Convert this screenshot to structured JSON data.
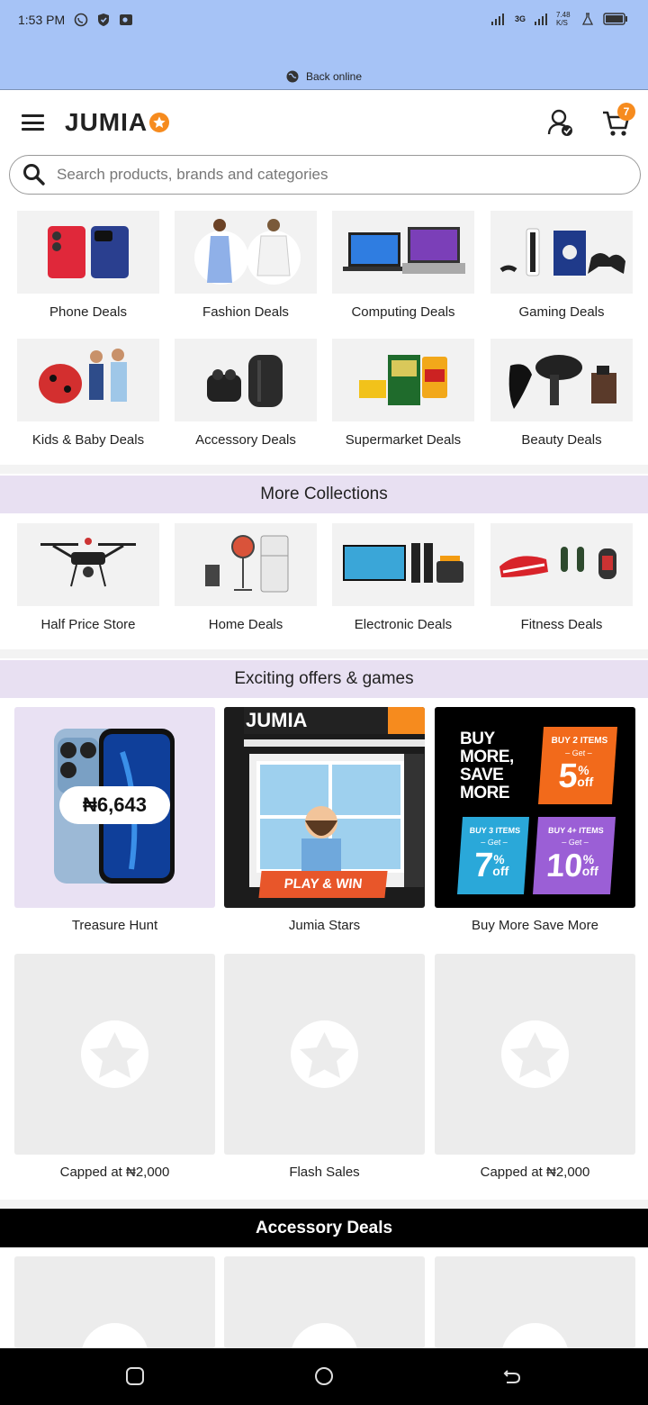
{
  "status_bar": {
    "time": "1:53 PM",
    "network": "3G",
    "speed": "7.48 K/S",
    "back_online": "Back online"
  },
  "header": {
    "logo": "JUMIA",
    "cart_count": "7"
  },
  "search": {
    "placeholder": "Search products, brands and categories"
  },
  "deals": [
    {
      "label": "Phone Deals"
    },
    {
      "label": "Fashion Deals"
    },
    {
      "label": "Computing Deals"
    },
    {
      "label": "Gaming Deals"
    },
    {
      "label": "Kids & Baby Deals"
    },
    {
      "label": "Accessory Deals"
    },
    {
      "label": "Supermarket Deals"
    },
    {
      "label": "Beauty Deals"
    }
  ],
  "more_collections": {
    "title": "More Collections",
    "items": [
      {
        "label": "Half Price Store"
      },
      {
        "label": "Home Deals"
      },
      {
        "label": "Electronic Deals"
      },
      {
        "label": "Fitness Deals"
      }
    ]
  },
  "offers": {
    "title": "Exciting offers & games",
    "items": [
      {
        "label": "Treasure Hunt",
        "price": "₦6,643"
      },
      {
        "label": "Jumia Stars",
        "brand": "JUMIA",
        "cta": "PLAY & WIN"
      },
      {
        "label": "Buy More Save More",
        "headline": "BUY MORE, SAVE MORE",
        "tiers": [
          {
            "qty": "BUY 2 ITEMS",
            "get": "– Get –",
            "pct": "5"
          },
          {
            "qty": "BUY 3 ITEMS",
            "get": "– Get –",
            "pct": "7"
          },
          {
            "qty": "BUY 4+ ITEMS",
            "get": "– Get –",
            "pct": "10"
          }
        ],
        "off": "off"
      },
      {
        "label": "Capped at ₦2,000"
      },
      {
        "label": "Flash Sales"
      },
      {
        "label": "Capped at ₦2,000"
      }
    ]
  },
  "accessory_deals": {
    "title": "Accessory Deals"
  },
  "colors": {
    "accent": "#f68b1e",
    "band": "#e8e0f2",
    "status_bg": "#a6c3f6"
  }
}
